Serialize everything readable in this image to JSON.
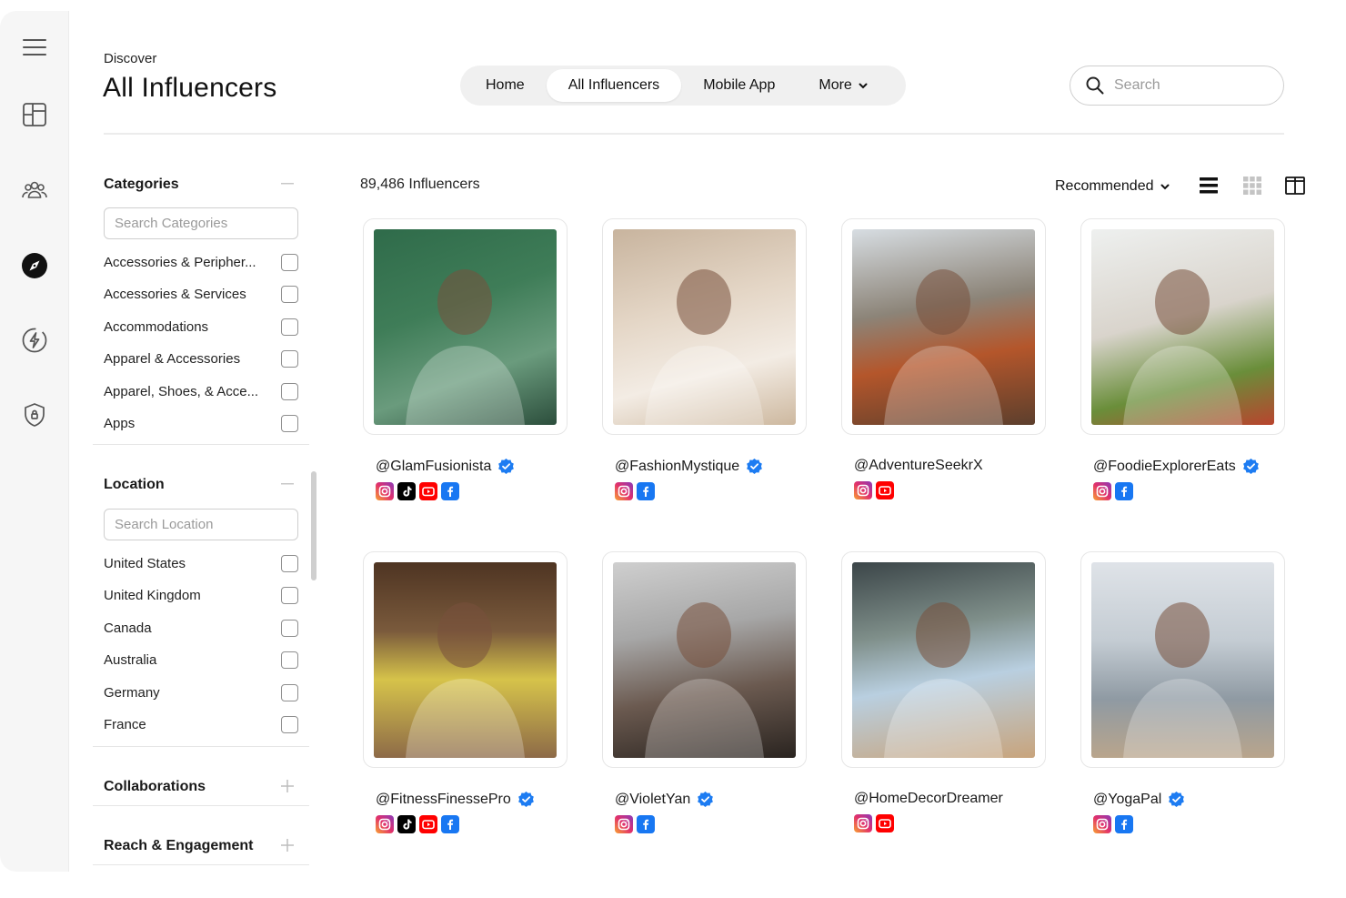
{
  "header": {
    "eyebrow": "Discover",
    "title": "All Influencers"
  },
  "nav": {
    "items": [
      {
        "label": "Home"
      },
      {
        "label": "All Influencers"
      },
      {
        "label": "Mobile App"
      },
      {
        "label": "More"
      }
    ],
    "active_index": 1
  },
  "search": {
    "placeholder": "Search"
  },
  "rail": {
    "icons": [
      "menu-icon",
      "dashboard-icon",
      "users-icon",
      "compass-icon",
      "lightning-icon",
      "shield-icon"
    ],
    "active": "compass-icon"
  },
  "filters": {
    "categories": {
      "title": "Categories",
      "search_placeholder": "Search Categories",
      "options": [
        "Accessories & Peripher...",
        "Accessories & Services",
        "Accommodations",
        "Apparel & Accessories",
        "Apparel, Shoes, & Acce...",
        "Apps"
      ]
    },
    "location": {
      "title": "Location",
      "search_placeholder": "Search Location",
      "options": [
        "United States",
        "United Kingdom",
        "Canada",
        "Australia",
        "Germany",
        "France"
      ]
    },
    "collaborations": {
      "title": "Collaborations"
    },
    "reach": {
      "title": "Reach & Engagement"
    }
  },
  "results": {
    "count_label": "89,486 Influencers",
    "sort_label": "Recommended"
  },
  "colors": {
    "verified": "#1d7cf2",
    "instagram": "#e1306c",
    "tiktok": "#000000",
    "youtube": "#ff0000",
    "facebook": "#1877f2"
  },
  "influencers": [
    {
      "handle": "@GlamFusionista",
      "verified": true,
      "platforms": [
        "instagram",
        "tiktok",
        "youtube",
        "facebook"
      ]
    },
    {
      "handle": "@FashionMystique",
      "verified": true,
      "platforms": [
        "instagram",
        "facebook"
      ]
    },
    {
      "handle": "@AdventureSeekrX",
      "verified": false,
      "platforms": [
        "instagram",
        "youtube"
      ]
    },
    {
      "handle": "@FoodieExplorerEats",
      "verified": true,
      "platforms": [
        "instagram",
        "facebook"
      ]
    },
    {
      "handle": "@FitnessFinessePro",
      "verified": true,
      "platforms": [
        "instagram",
        "tiktok",
        "youtube",
        "facebook"
      ]
    },
    {
      "handle": "@VioletYan",
      "verified": true,
      "platforms": [
        "instagram",
        "facebook"
      ]
    },
    {
      "handle": "@HomeDecorDreamer",
      "verified": false,
      "platforms": [
        "instagram",
        "youtube"
      ]
    },
    {
      "handle": "@YogaPal",
      "verified": true,
      "platforms": [
        "instagram",
        "facebook"
      ]
    }
  ]
}
